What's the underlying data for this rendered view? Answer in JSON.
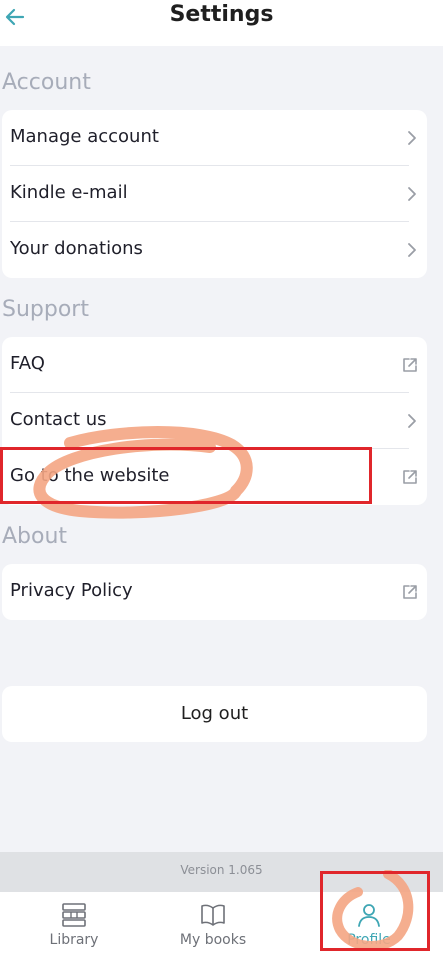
{
  "header": {
    "title": "Settings",
    "back_icon": "arrow-left-icon"
  },
  "sections": {
    "account": {
      "title": "Account",
      "items": [
        {
          "label": "Manage account",
          "icon": "chevron-right-icon"
        },
        {
          "label": "Kindle e-mail",
          "icon": "chevron-right-icon"
        },
        {
          "label": "Your donations",
          "icon": "chevron-right-icon"
        }
      ]
    },
    "support": {
      "title": "Support",
      "items": [
        {
          "label": "FAQ",
          "icon": "external-link-icon"
        },
        {
          "label": "Contact us",
          "icon": "chevron-right-icon"
        },
        {
          "label": "Go to the website",
          "icon": "external-link-icon"
        }
      ]
    },
    "about": {
      "title": "About",
      "items": [
        {
          "label": "Privacy Policy",
          "icon": "external-link-icon"
        }
      ]
    }
  },
  "logout_label": "Log out",
  "version": "Version 1.065",
  "nav": [
    {
      "label": "Library",
      "icon": "books-stack-icon",
      "active": false
    },
    {
      "label": "My books",
      "icon": "open-book-icon",
      "active": false
    },
    {
      "label": "Profile",
      "icon": "person-icon",
      "active": true
    }
  ],
  "colors": {
    "accent": "#3ea6b4",
    "annotation_red": "#e0262b",
    "annotation_orange": "#f4a583",
    "section_title": "#a7acb9"
  }
}
